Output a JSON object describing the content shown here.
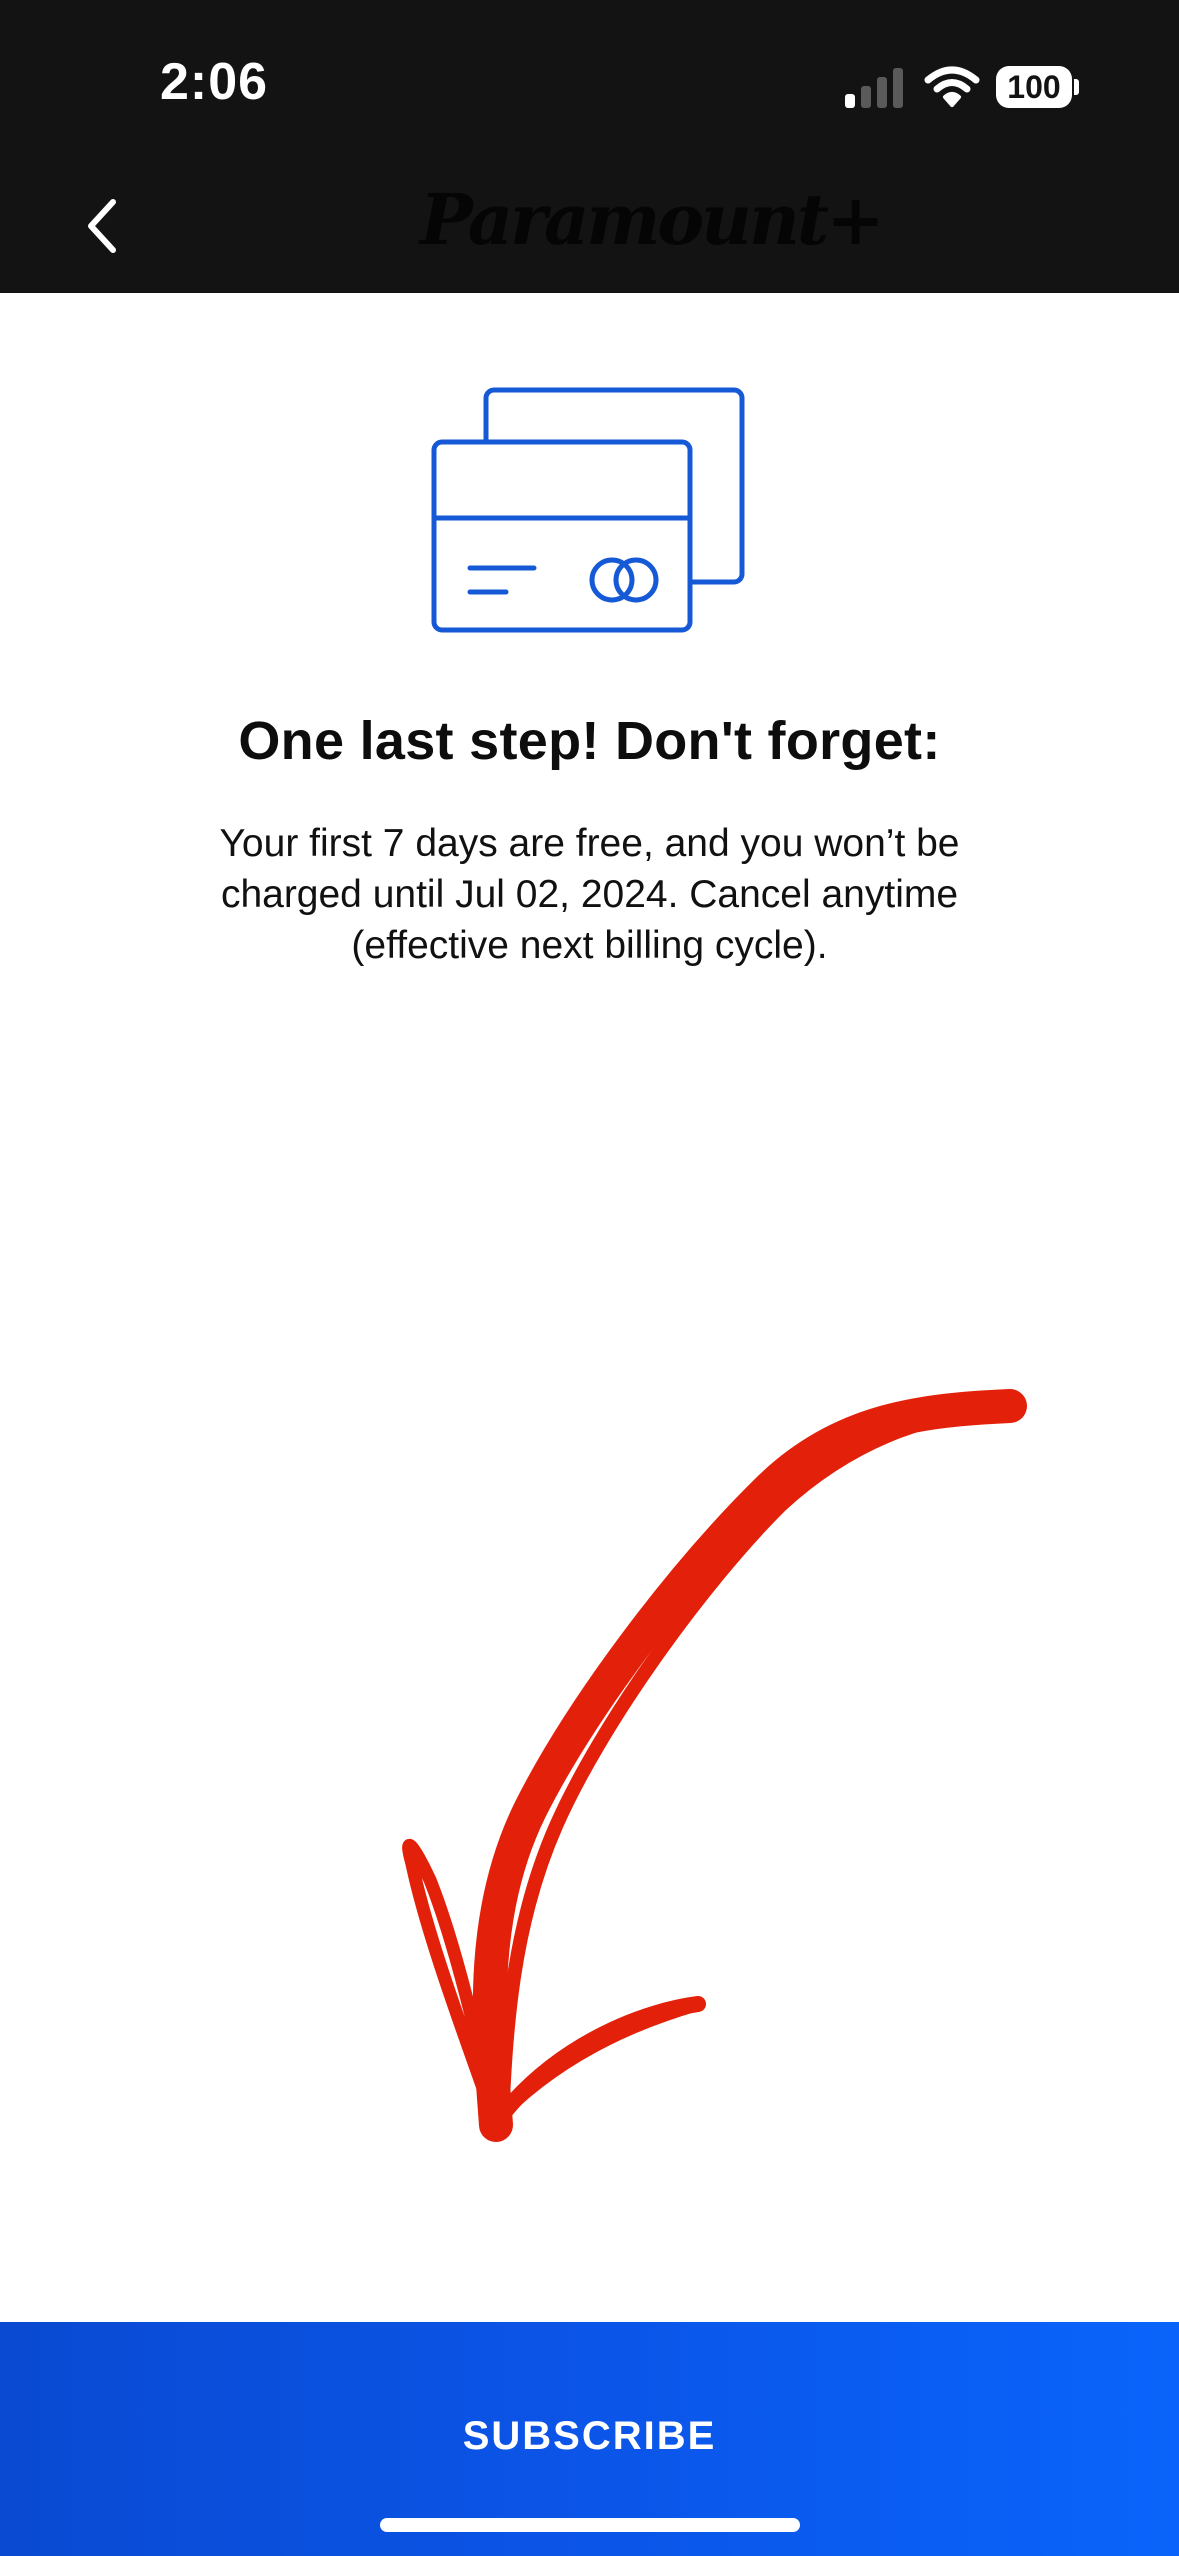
{
  "status_bar": {
    "time": "2:06",
    "battery": "100",
    "signal_icon": "cellular-signal-icon",
    "wifi_icon": "wifi-icon"
  },
  "nav": {
    "back_icon": "chevron-left-icon",
    "brand": "Paramount+"
  },
  "main": {
    "illustration_icon": "credit-cards-icon",
    "headline": "One last step! Don't forget:",
    "body": "Your first 7 days are free, and you won’t be charged until Jul 02, 2024. Cancel anytime (effective next billing cycle)."
  },
  "annotation": {
    "arrow_icon": "red-hand-drawn-arrow-icon"
  },
  "footer": {
    "subscribe_label": "SUBSCRIBE"
  },
  "colors": {
    "header_bg": "#131313",
    "accent_blue": "#0b55e8",
    "card_icon_blue": "#1559d6",
    "arrow_red": "#e3210b"
  }
}
